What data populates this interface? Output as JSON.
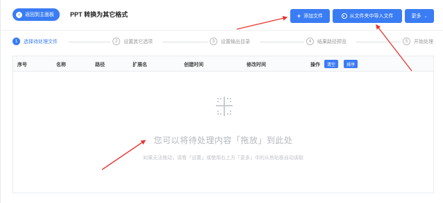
{
  "header": {
    "back_label": "返回到主面板",
    "title": "PPT 转换为其它格式",
    "add_file": "添加文件",
    "import_folder": "从文件夹中导入文件",
    "more": "更多"
  },
  "steps": [
    {
      "num": "1",
      "label": "选择待处理文件"
    },
    {
      "num": "2",
      "label": "设置其它选项"
    },
    {
      "num": "3",
      "label": "设置输出目录"
    },
    {
      "num": "4",
      "label": "结果路径预览"
    },
    {
      "num": "5",
      "label": "开始处理"
    }
  ],
  "table": {
    "columns": [
      "序号",
      "名称",
      "路径",
      "扩展名",
      "创建时间",
      "修改时间",
      "操作"
    ],
    "clear_label": "清空",
    "sort_label": "排序"
  },
  "empty": {
    "main": "您可以将待处理内容「拖放」到此处",
    "sub": "如果无法拖动，请看「设置」或使用右上方「更多」中的从剪贴板自动读取"
  },
  "colors": {
    "accent": "#3a7cf3",
    "arrow": "#e53935"
  }
}
